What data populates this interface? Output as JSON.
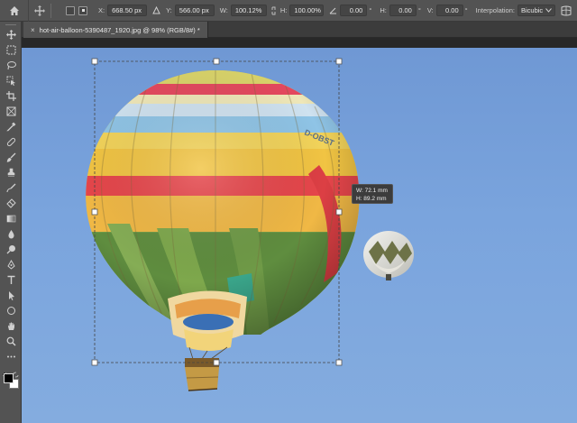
{
  "options": {
    "x_label": "X:",
    "x_value": "668.50 px",
    "y_label": "Y:",
    "y_value": "566.00 px",
    "w_label": "W:",
    "w_value": "100.12%",
    "h_label": "H:",
    "h_value": "100.00%",
    "angle_value": "0.00",
    "angle_unit": "°",
    "hskew_label": "H:",
    "hskew_value": "0.00",
    "hskew_unit": "°",
    "vskew_label": "V:",
    "vskew_value": "0.00",
    "vskew_unit": "°",
    "interp_label": "Interpolation:",
    "interp_value": "Bicubic"
  },
  "document": {
    "tab_title": "hot-air-balloon-5390487_1920.jpg @ 98% (RGB/8#) *",
    "close_glyph": "×"
  },
  "transform": {
    "width_readout": "W: 72.1 mm",
    "height_readout": "H: 89.2 mm"
  },
  "balloon": {
    "registration": "D-OBST"
  },
  "colors": {
    "sky": "#7aa4dd",
    "panel": "#535353",
    "selection": "#444444"
  }
}
